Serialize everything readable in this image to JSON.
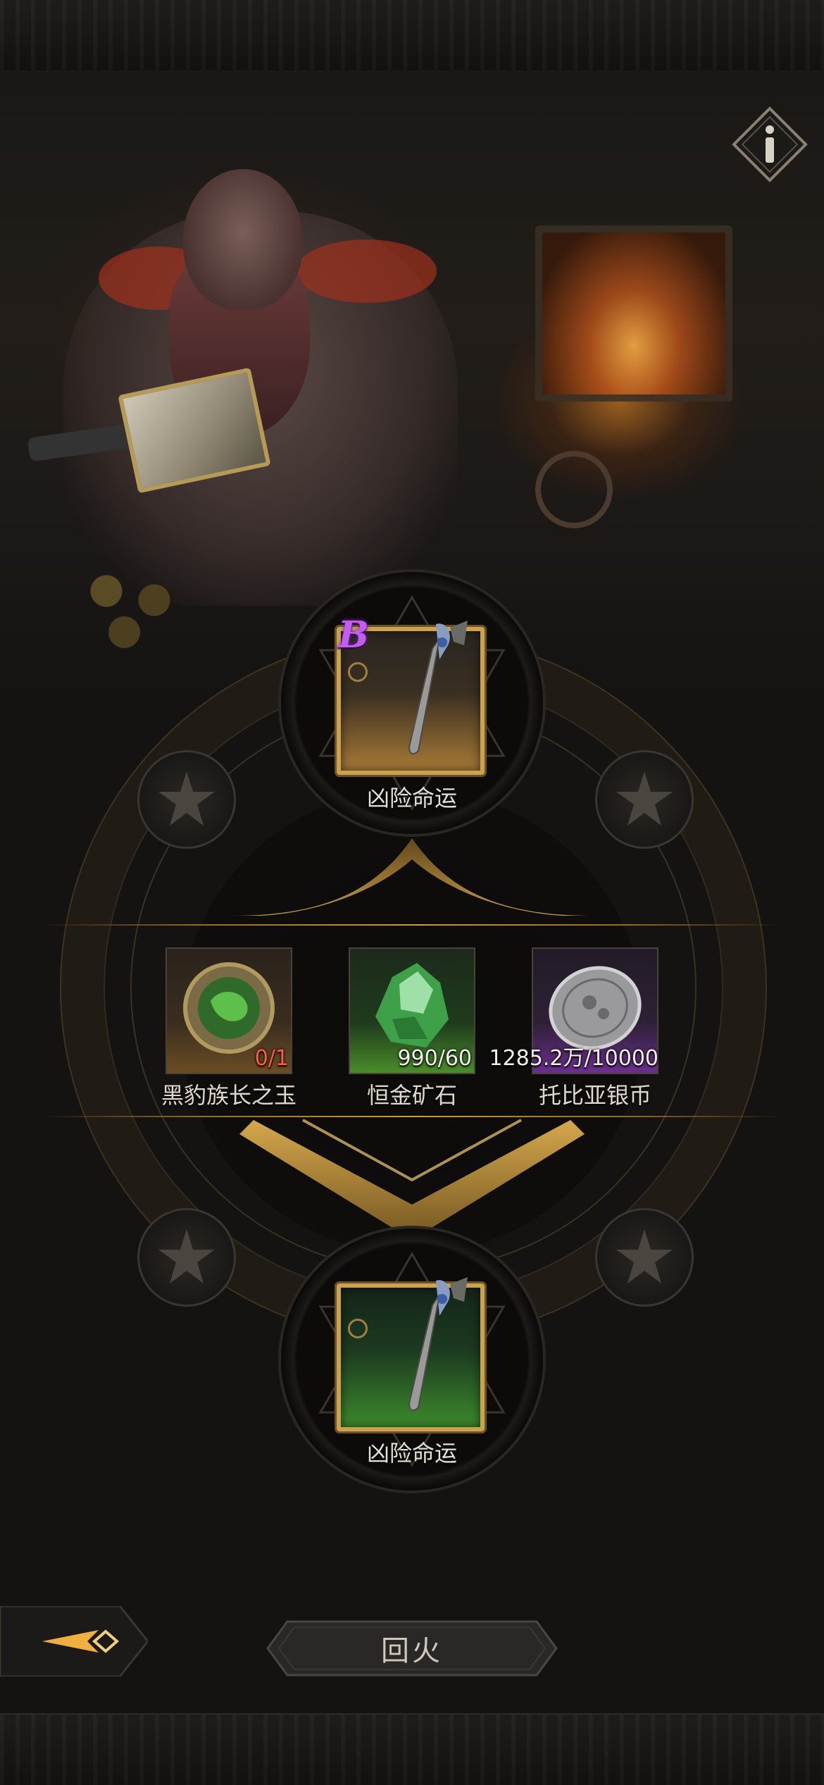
{
  "top_item": {
    "name": "凶险命运",
    "grade": "B"
  },
  "materials": [
    {
      "name": "黑豹族长之玉",
      "count": "0/1",
      "count_color": "#ff5a4a",
      "icon": "jade-amulet-icon"
    },
    {
      "name": "恒金矿石",
      "count": "990/60",
      "count_color": "#f2f0ea",
      "icon": "green-ore-icon"
    },
    {
      "name": "托比亚银币",
      "count": "1285.2万/10000",
      "count_color": "#f2f0ea",
      "icon": "silver-coin-icon"
    }
  ],
  "bottom_item": {
    "name": "凶险命运"
  },
  "buttons": {
    "confirm_label": "回火"
  },
  "colors": {
    "accent_gold": "#c9a252",
    "grade_purple": "#c35cf0",
    "insufficient_red": "#ff5a4a"
  }
}
